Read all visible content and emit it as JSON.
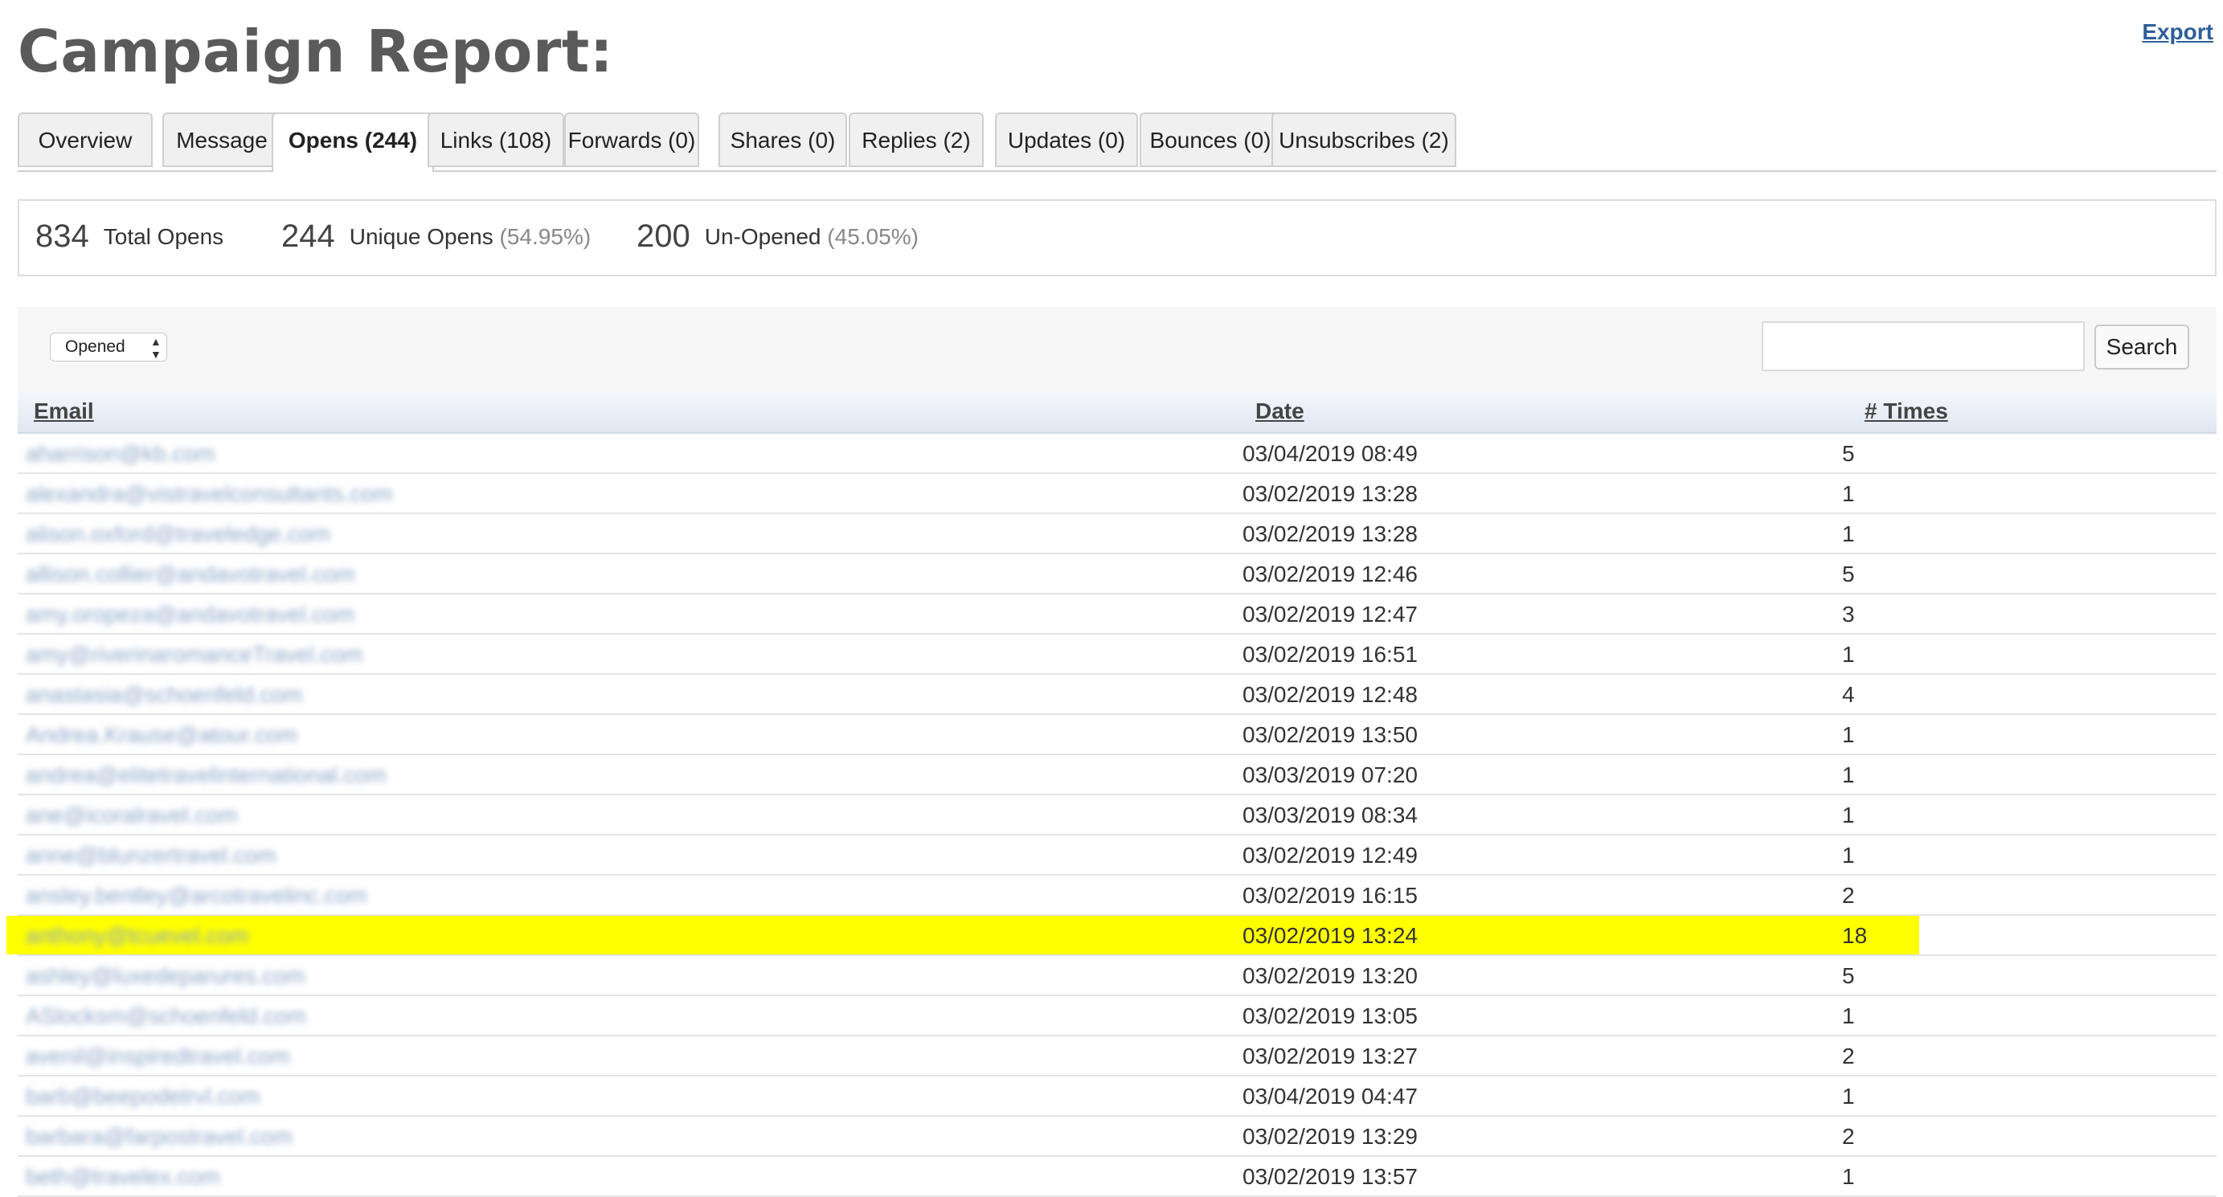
{
  "header": {
    "title": "Campaign Report:",
    "export_label": "Export"
  },
  "tabs": [
    {
      "label": "Overview"
    },
    {
      "label": "Message"
    },
    {
      "label": "Opens (244)"
    },
    {
      "label": "Links (108)"
    },
    {
      "label": "Forwards (0)"
    },
    {
      "label": "Shares (0)"
    },
    {
      "label": "Replies (2)"
    },
    {
      "label": "Updates (0)"
    },
    {
      "label": "Bounces (0)"
    },
    {
      "label": "Unsubscribes (2)"
    }
  ],
  "active_tab": "Opens (244)",
  "stats": {
    "total_opens": {
      "value": "834",
      "label": "Total Opens"
    },
    "unique_opens": {
      "value": "244",
      "label": "Unique Opens",
      "pct": "(54.95%)"
    },
    "unopened": {
      "value": "200",
      "label": "Un-Opened",
      "pct": "(45.05%)"
    }
  },
  "filter": {
    "selected": "Opened",
    "arrows": "▲▼"
  },
  "search": {
    "value": "",
    "button_label": "Search"
  },
  "table": {
    "columns": {
      "email": "Email",
      "date": "Date",
      "times": "# Times"
    },
    "rows": [
      {
        "email": "aharrison@kb.com",
        "date": "03/04/2019 08:49",
        "times": "5"
      },
      {
        "email": "alexandra@vistravelconsultants.com",
        "date": "03/02/2019 13:28",
        "times": "1"
      },
      {
        "email": "alison.oxford@traveledge.com",
        "date": "03/02/2019 13:28",
        "times": "1"
      },
      {
        "email": "allison.collier@andavotravel.com",
        "date": "03/02/2019 12:46",
        "times": "5"
      },
      {
        "email": "amy.oropeza@andavotravel.com",
        "date": "03/02/2019 12:47",
        "times": "3"
      },
      {
        "email": "amy@riverinaromanceTravel.com",
        "date": "03/02/2019 16:51",
        "times": "1"
      },
      {
        "email": "anastasia@schoenfeld.com",
        "date": "03/02/2019 12:48",
        "times": "4"
      },
      {
        "email": "Andrea.Krause@atour.com",
        "date": "03/02/2019 13:50",
        "times": "1"
      },
      {
        "email": "andrea@elitetravelinternational.com",
        "date": "03/03/2019 07:20",
        "times": "1"
      },
      {
        "email": "ane@icoralravel.com",
        "date": "03/03/2019 08:34",
        "times": "1"
      },
      {
        "email": "anne@blunzertravel.com",
        "date": "03/02/2019 12:49",
        "times": "1"
      },
      {
        "email": "ansley.bentley@arcotravelinc.com",
        "date": "03/02/2019 16:15",
        "times": "2"
      },
      {
        "email": "anthony@tcuevel.com",
        "date": "03/02/2019 13:24",
        "times": "18",
        "highlight": true
      },
      {
        "email": "ashley@luxedeparures.com",
        "date": "03/02/2019 13:20",
        "times": "5"
      },
      {
        "email": "ASlocksm@schoenfeld.com",
        "date": "03/02/2019 13:05",
        "times": "1"
      },
      {
        "email": "avenil@inspiredtravel.com",
        "date": "03/02/2019 13:27",
        "times": "2"
      },
      {
        "email": "barb@beepodetrvl.com",
        "date": "03/04/2019 04:47",
        "times": "1"
      },
      {
        "email": "barbara@farpostravel.com",
        "date": "03/02/2019 13:29",
        "times": "2"
      },
      {
        "email": "beth@travelex.com",
        "date": "03/02/2019 13:57",
        "times": "1"
      }
    ]
  }
}
